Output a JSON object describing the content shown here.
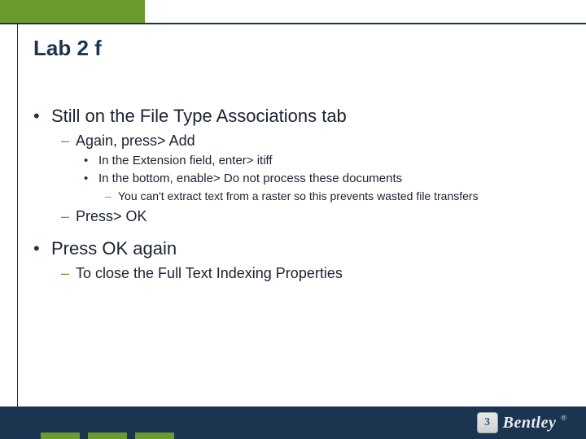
{
  "title": "Lab 2 f",
  "content": {
    "items": [
      {
        "text": "Still on the File Type Associations tab",
        "children": [
          {
            "text": "Again, press> Add",
            "children": [
              {
                "text": "In the Extension field, enter> itiff"
              },
              {
                "text": "In the bottom, enable> Do not process these documents",
                "children": [
                  {
                    "text": "You can't extract text from a raster so this prevents wasted file transfers"
                  }
                ]
              }
            ]
          },
          {
            "text": "Press> OK"
          }
        ]
      },
      {
        "text": "Press OK again",
        "children": [
          {
            "text": "To close the Full Text Indexing Properties"
          }
        ]
      }
    ]
  },
  "logo": {
    "badge": "3",
    "text": "Bentley"
  }
}
